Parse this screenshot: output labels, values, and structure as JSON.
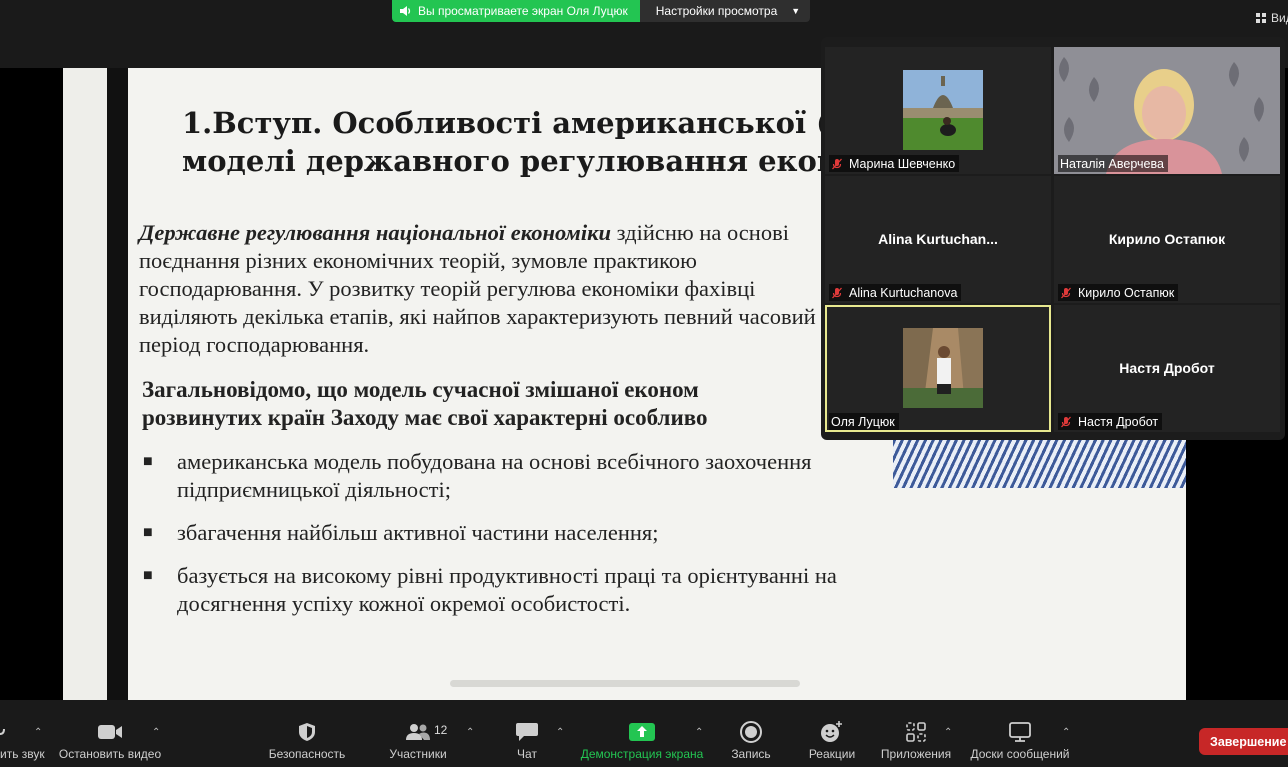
{
  "topbar": {
    "share_notice": "Вы просматриваете экран Оля Луцюк",
    "view_settings": "Настройки просмотра",
    "view_button": "Вид",
    "colors": {
      "share_green": "#23c552"
    }
  },
  "slide": {
    "title_line1": "1.Вступ. Особливості американської (",
    "title_line2": "моделі  державного регулювання еконо",
    "para1_lead": "Державне регулювання національної економіки",
    "para1_rest": " здійсню на основі поєднання різних економічних теорій, зумовле практикою господарювання. У розвитку теорій регулюва економіки фахівці виділяють декілька етапів, які найпов характеризують певний часовий період господарювання.",
    "para2_line1": "Загальновідомо, що модель сучасної змішаної економ",
    "para2_line2": "розвинутих країн Заходу має свої характерні особливо",
    "bullets": [
      "американська модель побудована на основі всебічного заохочення підприємницької діяльності;",
      "збагачення найбільш активної частини населення;",
      " базується на високому рівні продуктивності праці та орієнтуванні на досягнення успіху кожної окремої особистості."
    ],
    "bullet_mark": "■"
  },
  "gallery": {
    "tiles": [
      {
        "name": "Марина Шевченко",
        "muted": true,
        "has_video": true
      },
      {
        "name": "Наталія Аверчева",
        "muted": false,
        "has_video": true
      },
      {
        "name": "Alina Kurtuchanova",
        "display": "Alina  Kurtuchan...",
        "muted": true,
        "has_video": false
      },
      {
        "name": "Кирило Остапюк",
        "display": "Кирило Остапюк",
        "muted": true,
        "has_video": false
      },
      {
        "name": "Оля Луцюк",
        "muted": false,
        "has_video": true,
        "active": true
      },
      {
        "name": "Настя Дробот",
        "display": "Настя Дробот",
        "muted": true,
        "has_video": false
      }
    ],
    "colors": {
      "active_border": "#e7e88f",
      "muted_icon": "#e03a3a"
    }
  },
  "toolbar": {
    "audio": "ить звук",
    "video": "Остановить видео",
    "security": "Безопасность",
    "participants": "Участники",
    "participants_count": "12",
    "chat": "Чат",
    "share": "Демонстрация экрана",
    "record": "Запись",
    "reactions": "Реакции",
    "apps": "Приложения",
    "whiteboards": "Доски сообщений",
    "end": "Завершение",
    "caret": "⌃",
    "colors": {
      "share_icon": "#23c552",
      "end_button": "#c72727"
    }
  }
}
